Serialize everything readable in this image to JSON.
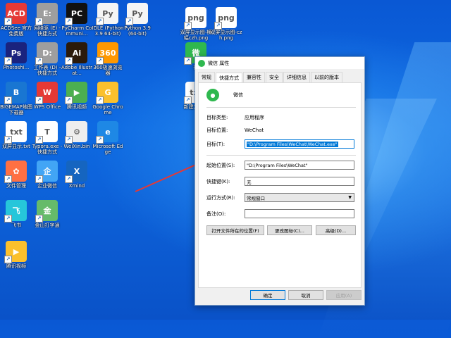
{
  "desktop": {
    "icons": [
      {
        "label": "ACDSee 官方免费版",
        "color": "#e53935",
        "glyph": "ACD"
      },
      {
        "label": "网络驱 (E) - 快捷方式",
        "color": "#9e9e9e",
        "glyph": "E:"
      },
      {
        "label": "PyCharm Communi...",
        "color": "#111111",
        "glyph": "PC"
      },
      {
        "label": "IDLE (Python 3.9 64-bit)",
        "color": "#f5f5f5",
        "glyph": "Py"
      },
      {
        "label": "Python 3.9 (64-bit)",
        "color": "#f5f5f5",
        "glyph": "Py"
      },
      {
        "label": "Photoshi...",
        "color": "#1a237e",
        "glyph": "Ps"
      },
      {
        "label": "工作表 (D) - 快捷方式",
        "color": "#9e9e9e",
        "glyph": "D:"
      },
      {
        "label": "Adobe Illustrat...",
        "color": "#2b1a0a",
        "glyph": "Ai"
      },
      {
        "label": "360极速浏览器",
        "color": "#ff9800",
        "glyph": "360"
      },
      {
        "label": "BIGEMAP地图下载器",
        "color": "#1976d2",
        "glyph": "B"
      },
      {
        "label": "WPS Office",
        "color": "#e53935",
        "glyph": "W"
      },
      {
        "label": "腾讯视频",
        "color": "#4caf50",
        "glyph": "▶"
      },
      {
        "label": "Google Chrome",
        "color": "#fbc02d",
        "glyph": "G"
      },
      {
        "label": "双屏显示.txt",
        "color": "#ffffff",
        "glyph": "txt"
      },
      {
        "label": "Typora.exe - 快捷方式",
        "color": "#ffffff",
        "glyph": "T"
      },
      {
        "label": "WeiXin.bin",
        "color": "#eeeeee",
        "glyph": "⚙"
      },
      {
        "label": "Microsoft Edge",
        "color": "#1e88e5",
        "glyph": "e"
      },
      {
        "label": "文件管理",
        "color": "#ff7043",
        "glyph": "✿"
      },
      {
        "label": "企业微信",
        "color": "#42a5f5",
        "glyph": "企"
      },
      {
        "label": "Xmind",
        "color": "#1565c0",
        "glyph": "X"
      },
      {
        "label": "飞书",
        "color": "#26c6da",
        "glyph": "飞"
      },
      {
        "label": "金山打字通",
        "color": "#66bb6a",
        "glyph": "金"
      },
      {
        "label": "腾讯视频",
        "color": "#fbc02d",
        "glyph": "▶"
      },
      {
        "label": "双屏显示图-横幅czh.png",
        "color": "#ffffff",
        "glyph": "png"
      },
      {
        "label": "双屏显示图-czh.png",
        "color": "#ffffff",
        "glyph": "png"
      },
      {
        "label": "微",
        "color": "#2fb84f",
        "glyph": "微"
      },
      {
        "label": "新建文本...",
        "color": "#ffffff",
        "glyph": "txt"
      }
    ]
  },
  "dialog": {
    "title": "微信 属性",
    "tabs": [
      "常规",
      "快捷方式",
      "兼容性",
      "安全",
      "详细信息",
      "以前的版本"
    ],
    "app_name": "微信",
    "target_type_label": "目标类型:",
    "target_type_value": "应用程序",
    "target_location_label": "目标位置:",
    "target_location_value": "WeChat",
    "target_label": "目标(T):",
    "target_value": "\"D:\\Program Files\\WeChat\\WeChat.exe\"",
    "start_in_label": "起始位置(S):",
    "start_in_value": "\"D:\\Program Files\\WeChat\"",
    "shortcut_key_label": "快捷键(K):",
    "shortcut_key_value": "无",
    "run_label": "运行方式(R):",
    "run_value": "常规窗口",
    "comment_label": "备注(O):",
    "comment_value": "",
    "btn_open_location": "打开文件所在的位置(F)",
    "btn_change_icon": "更改图标(C)...",
    "btn_advanced": "高级(D)...",
    "btn_ok": "确定",
    "btn_cancel": "取消",
    "btn_apply": "应用(A)"
  },
  "colors": {
    "arrow": "#e53935",
    "selection": "#0078d7",
    "wechat_green": "#2fb84f"
  }
}
